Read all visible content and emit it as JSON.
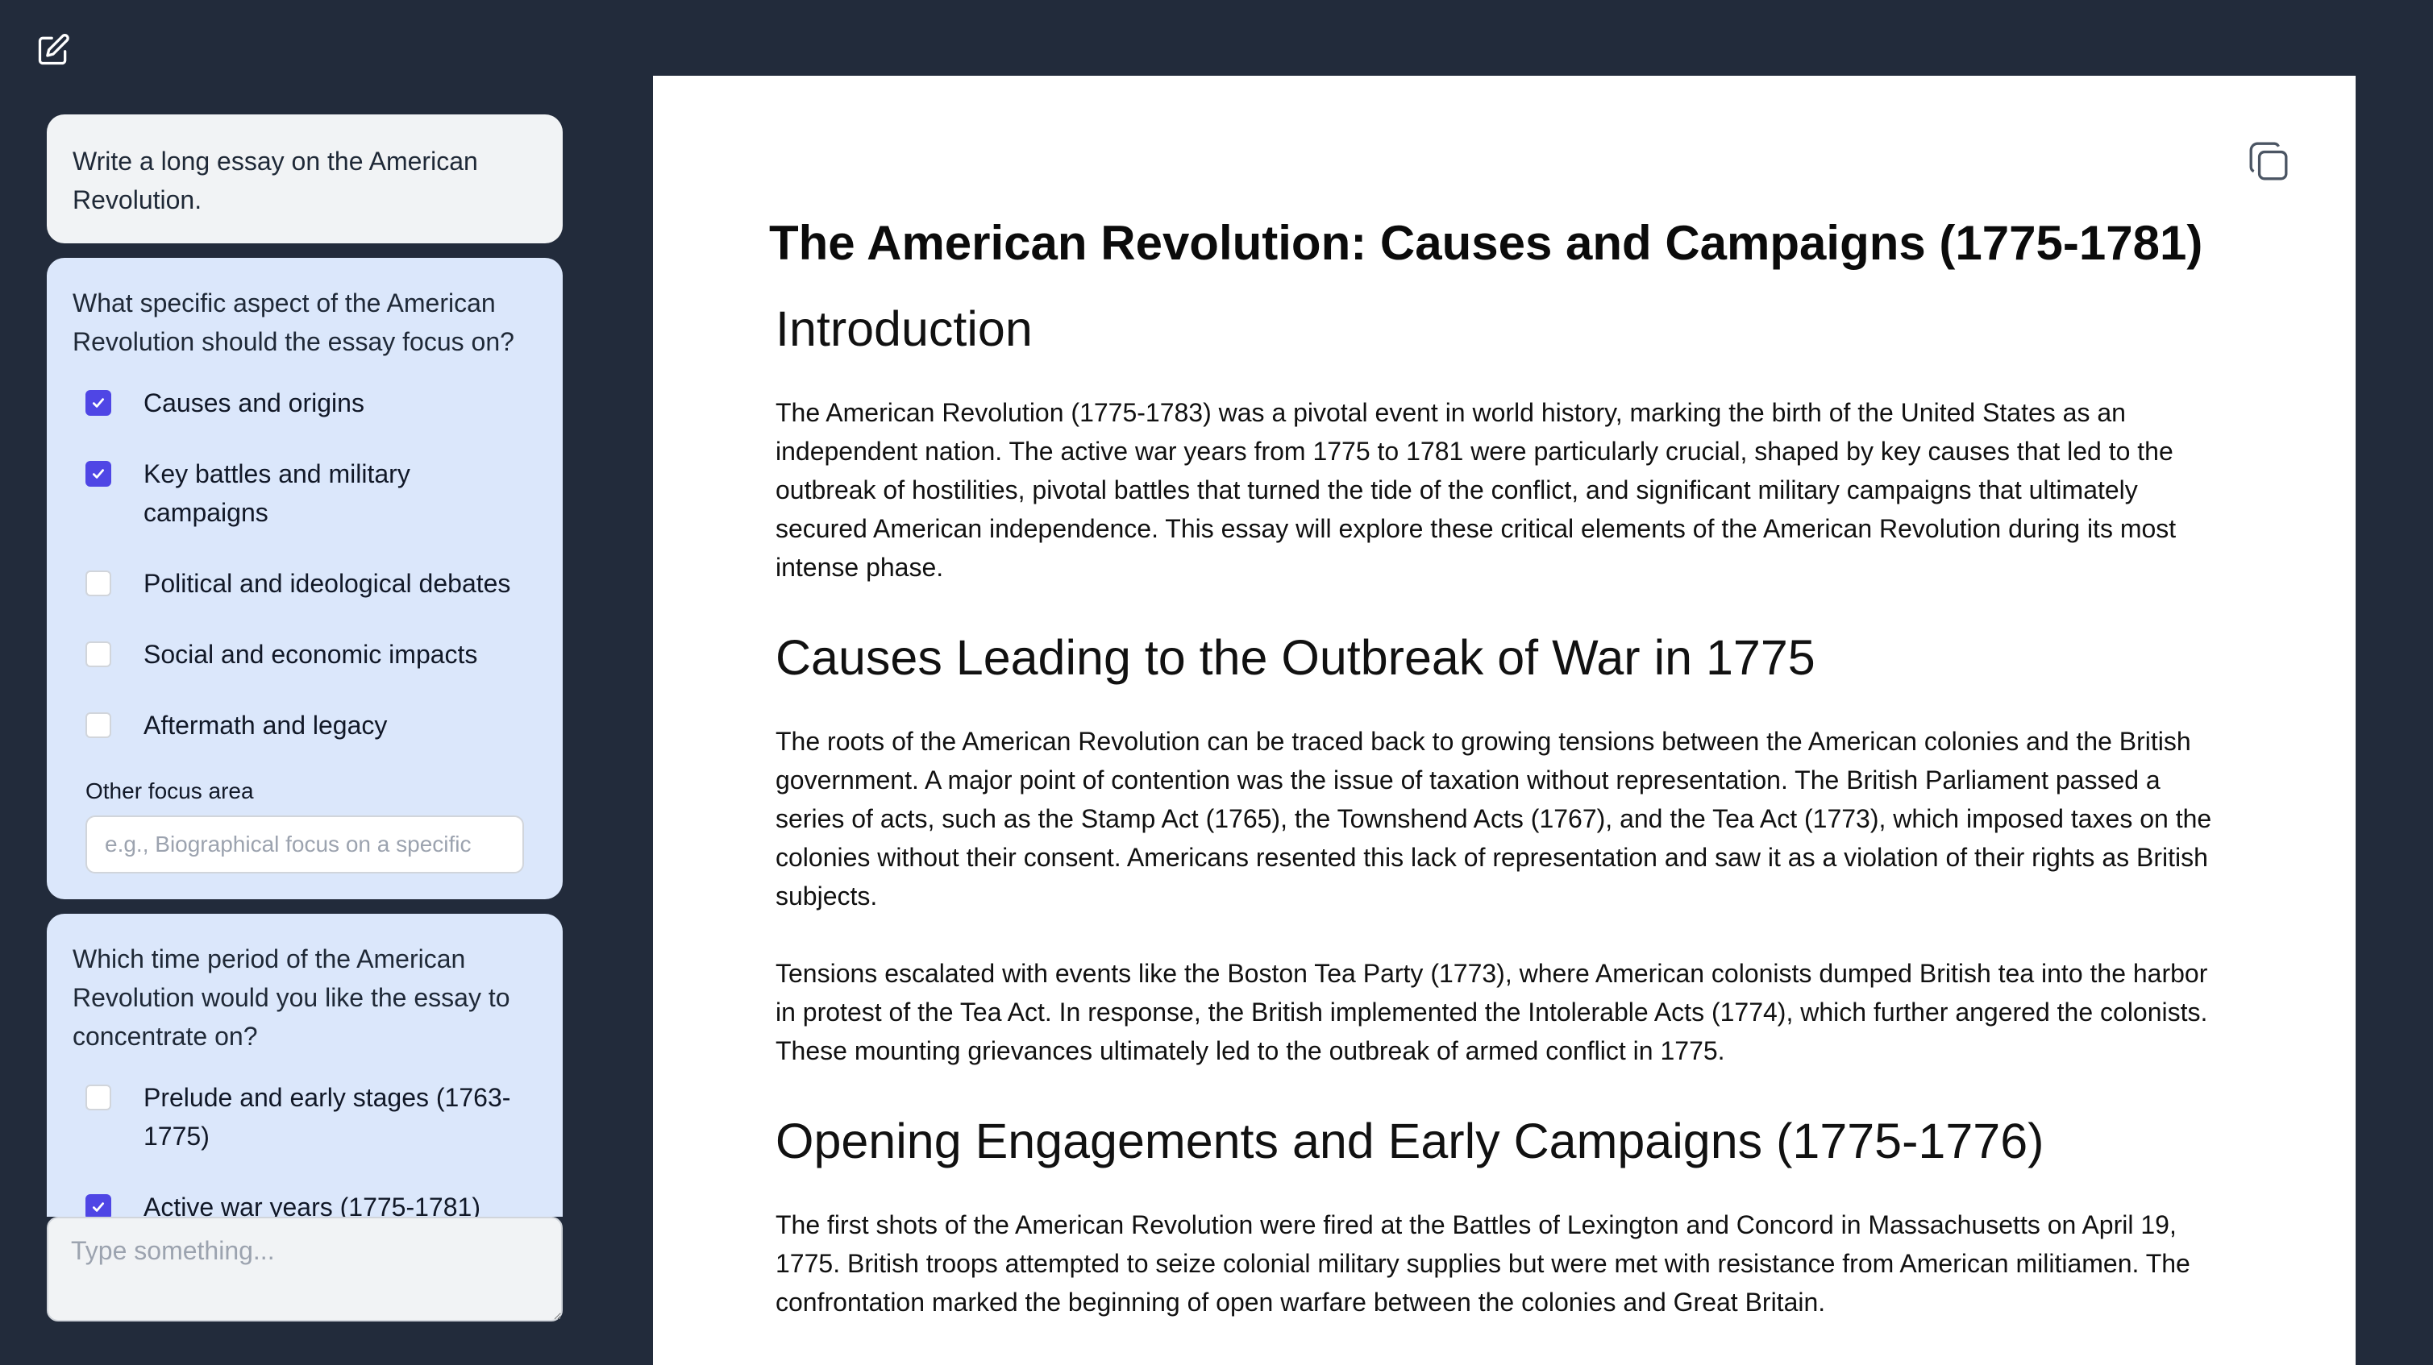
{
  "sidebar": {
    "user_message": "Write a long essay on the American Revolution.",
    "q1": {
      "question": "What specific aspect of the American Revolution should the essay focus on?",
      "options": [
        {
          "label": "Causes and origins",
          "checked": true
        },
        {
          "label": "Key battles and military campaigns",
          "checked": true
        },
        {
          "label": "Political and ideological debates",
          "checked": false
        },
        {
          "label": "Social and economic impacts",
          "checked": false
        },
        {
          "label": "Aftermath and legacy",
          "checked": false
        }
      ],
      "other_label": "Other focus area",
      "other_placeholder": "e.g., Biographical focus on a specific"
    },
    "q2": {
      "question": "Which time period of the American Revolution would you like the essay to concentrate on?",
      "options": [
        {
          "label": "Prelude and early stages (1763-1775)",
          "checked": false
        },
        {
          "label": "Active war years (1775-1781)",
          "checked": true
        }
      ]
    },
    "composer_placeholder": "Type something..."
  },
  "document": {
    "title": "The American Revolution: Causes and Campaigns (1775-1781)",
    "sections": [
      {
        "heading": "Introduction",
        "paragraphs": [
          "The American Revolution (1775-1783) was a pivotal event in world history, marking the birth of the United States as an independent nation. The active war years from 1775 to 1781 were particularly crucial, shaped by key causes that led to the outbreak of hostilities, pivotal battles that turned the tide of the conflict, and significant military campaigns that ultimately secured American independence. This essay will explore these critical elements of the American Revolution during its most intense phase."
        ]
      },
      {
        "heading": "Causes Leading to the Outbreak of War in 1775",
        "paragraphs": [
          "The roots of the American Revolution can be traced back to growing tensions between the American colonies and the British government. A major point of contention was the issue of taxation without representation. The British Parliament passed a series of acts, such as the Stamp Act (1765), the Townshend Acts (1767), and the Tea Act (1773), which imposed taxes on the colonies without their consent. Americans resented this lack of representation and saw it as a violation of their rights as British subjects.",
          "Tensions escalated with events like the Boston Tea Party (1773), where American colonists dumped British tea into the harbor in protest of the Tea Act. In response, the British implemented the Intolerable Acts (1774), which further angered the colonists. These mounting grievances ultimately led to the outbreak of armed conflict in 1775."
        ]
      },
      {
        "heading": "Opening Engagements and Early Campaigns (1775-1776)",
        "paragraphs": [
          "The first shots of the American Revolution were fired at the Battles of Lexington and Concord in Massachusetts on April 19, 1775. British troops attempted to seize colonial military supplies but were met with resistance from American militiamen. The confrontation marked the beginning of open warfare between the colonies and Great Britain."
        ]
      }
    ]
  },
  "colors": {
    "background": "#222b3b",
    "accent": "#4f46e5",
    "question_card": "#dbe7fb",
    "user_bubble": "#f1f3f5"
  },
  "icons": {
    "new_chat": "edit-icon",
    "copy": "copy-icon",
    "check": "check-icon"
  }
}
